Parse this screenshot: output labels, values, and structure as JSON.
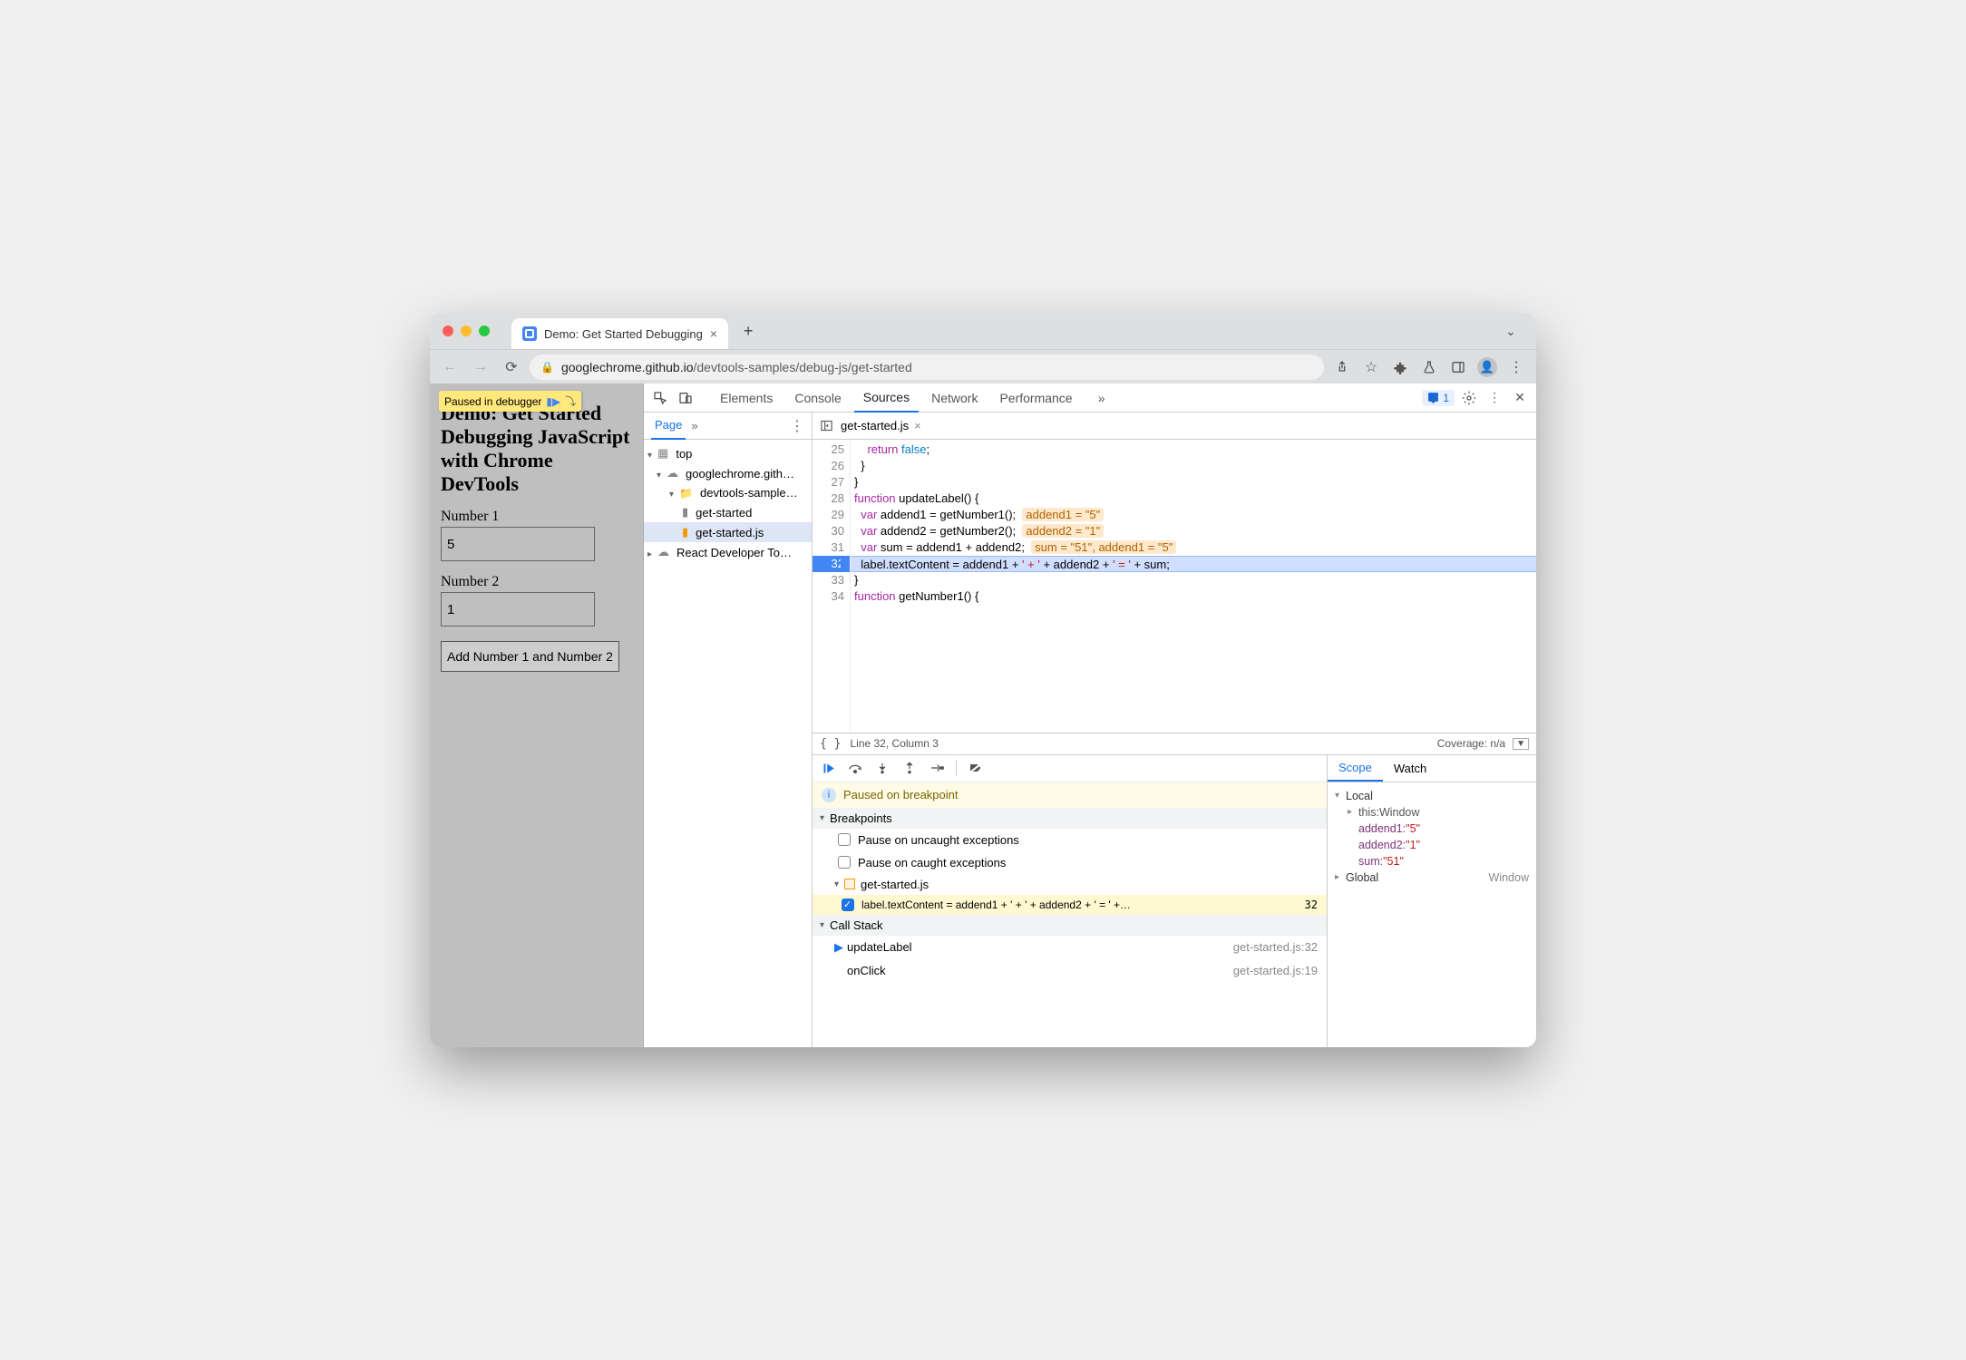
{
  "browser": {
    "tab_title": "Demo: Get Started Debugging",
    "url_host": "googlechrome.github.io",
    "url_path": "/devtools-samples/debug-js/get-started"
  },
  "page": {
    "paused_overlay": "Paused in debugger",
    "heading": "Demo: Get Started Debugging JavaScript with Chrome DevTools",
    "num1_label": "Number 1",
    "num1_value": "5",
    "num2_label": "Number 2",
    "num2_value": "1",
    "button": "Add Number 1 and Number 2"
  },
  "devtools": {
    "tabs": [
      "Elements",
      "Console",
      "Sources",
      "Network",
      "Performance"
    ],
    "active_tab": "Sources",
    "issues_count": "1"
  },
  "navigator": {
    "page": "Page",
    "top": "top",
    "domain": "googlechrome.gith…",
    "folder": "devtools-sample…",
    "html": "get-started",
    "js": "get-started.js",
    "react": "React Developer To…"
  },
  "editor": {
    "filename": "get-started.js",
    "lines": [
      {
        "n": 25,
        "tokens": [
          {
            "t": "    ",
            "c": ""
          },
          {
            "t": "return",
            "c": "kw"
          },
          {
            "t": " ",
            "c": ""
          },
          {
            "t": "false",
            "c": "lit"
          },
          {
            "t": ";",
            "c": ""
          }
        ]
      },
      {
        "n": 26,
        "tokens": [
          {
            "t": "  }",
            "c": ""
          }
        ]
      },
      {
        "n": 27,
        "tokens": [
          {
            "t": "}",
            "c": ""
          }
        ]
      },
      {
        "n": 28,
        "tokens": [
          {
            "t": "function",
            "c": "kw"
          },
          {
            "t": " updateLabel() {",
            "c": ""
          }
        ]
      },
      {
        "n": 29,
        "tokens": [
          {
            "t": "  ",
            "c": ""
          },
          {
            "t": "var",
            "c": "kw"
          },
          {
            "t": " addend1 = getNumber1();  ",
            "c": ""
          }
        ],
        "annot": "addend1 = \"5\""
      },
      {
        "n": 30,
        "tokens": [
          {
            "t": "  ",
            "c": ""
          },
          {
            "t": "var",
            "c": "kw"
          },
          {
            "t": " addend2 = getNumber2();  ",
            "c": ""
          }
        ],
        "annot": "addend2 = \"1\""
      },
      {
        "n": 31,
        "tokens": [
          {
            "t": "  ",
            "c": ""
          },
          {
            "t": "var",
            "c": "kw"
          },
          {
            "t": " sum = addend1 + addend2;  ",
            "c": ""
          }
        ],
        "annot": "sum = \"51\", addend1 = \"5\""
      },
      {
        "n": 32,
        "exec": true,
        "tokens": [
          {
            "t": "  label",
            "c": ""
          },
          {
            "t": ".textContent = addend1 + ",
            "c": ""
          },
          {
            "t": "' + '",
            "c": "str"
          },
          {
            "t": " + addend2 + ",
            "c": ""
          },
          {
            "t": "' = '",
            "c": "str"
          },
          {
            "t": " + sum;",
            "c": ""
          }
        ]
      },
      {
        "n": 33,
        "tokens": [
          {
            "t": "}",
            "c": ""
          }
        ]
      },
      {
        "n": 34,
        "tokens": [
          {
            "t": "function",
            "c": "kw"
          },
          {
            "t": " getNumber1() {",
            "c": ""
          }
        ]
      }
    ],
    "status_cursor": "Line 32, Column 3",
    "coverage": "Coverage: n/a"
  },
  "debugger": {
    "paused_msg": "Paused on breakpoint",
    "breakpoints_label": "Breakpoints",
    "pause_uncaught": "Pause on uncaught exceptions",
    "pause_caught": "Pause on caught exceptions",
    "bp_file": "get-started.js",
    "bp_line_text": "label.textContent = addend1 + ' + ' + addend2 + ' = ' +…",
    "bp_line_num": "32",
    "callstack_label": "Call Stack",
    "stack": [
      {
        "fn": "updateLabel",
        "loc": "get-started.js:32",
        "current": true
      },
      {
        "fn": "onClick",
        "loc": "get-started.js:19",
        "current": false
      }
    ]
  },
  "scope": {
    "tabs": {
      "scope": "Scope",
      "watch": "Watch"
    },
    "local": "Local",
    "this_label": "this",
    "this_val": "Window",
    "vars": [
      {
        "k": "addend1",
        "v": "\"5\""
      },
      {
        "k": "addend2",
        "v": "\"1\""
      },
      {
        "k": "sum",
        "v": "\"51\""
      }
    ],
    "global": "Global",
    "global_val": "Window"
  }
}
